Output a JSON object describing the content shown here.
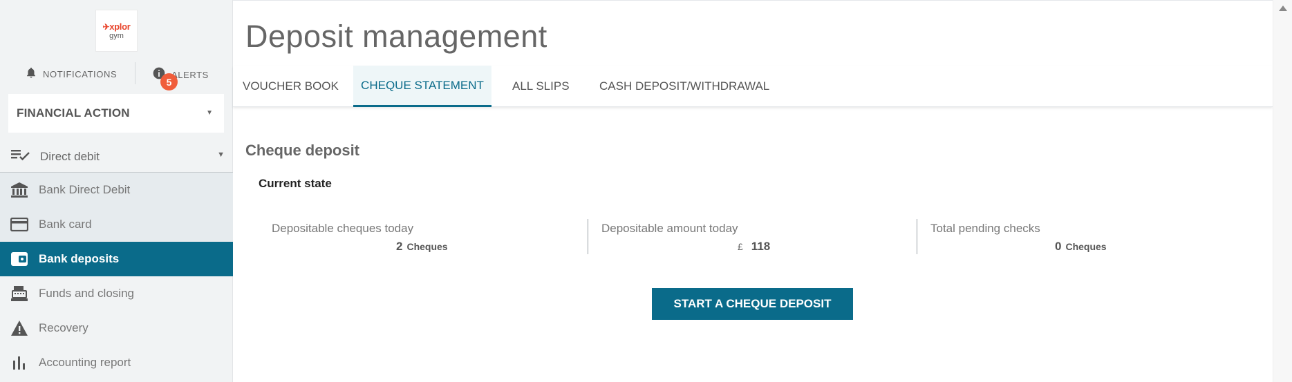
{
  "sidebar": {
    "logo": {
      "brand": "xplor",
      "sub": "gym"
    },
    "notifications_label": "NOTIFICATIONS",
    "alerts_label": "ALERTS",
    "alerts_count": "5",
    "financial_select": "FINANCIAL ACTION",
    "section_label": "Direct debit",
    "items": [
      {
        "label": "Bank Direct Debit",
        "icon": "bank-icon"
      },
      {
        "label": "Bank card",
        "icon": "credit-card-icon"
      },
      {
        "label": "Bank deposits",
        "icon": "wallet-icon"
      },
      {
        "label": "Funds and closing",
        "icon": "cash-register-icon"
      },
      {
        "label": "Recovery",
        "icon": "warning-icon"
      },
      {
        "label": "Accounting report",
        "icon": "bar-chart-icon"
      }
    ]
  },
  "main": {
    "title": "Deposit management",
    "tabs": [
      {
        "label": "VOUCHER BOOK"
      },
      {
        "label": "CHEQUE STATEMENT"
      },
      {
        "label": "ALL SLIPS"
      },
      {
        "label": "CASH DEPOSIT/WITHDRAWAL"
      }
    ],
    "section_title": "Cheque deposit",
    "subsection_title": "Current state",
    "stats": [
      {
        "label": "Depositable cheques today",
        "value": "2",
        "unit": "Cheques"
      },
      {
        "label": "Depositable amount today",
        "currency": "£",
        "value": "118"
      },
      {
        "label": "Total pending checks",
        "value": "0",
        "unit": "Cheques"
      }
    ],
    "cta_label": "START A CHEQUE DEPOSIT"
  },
  "colors": {
    "accent": "#0a6b8a",
    "badge": "#f05d3b",
    "logo": "#e8452c"
  }
}
